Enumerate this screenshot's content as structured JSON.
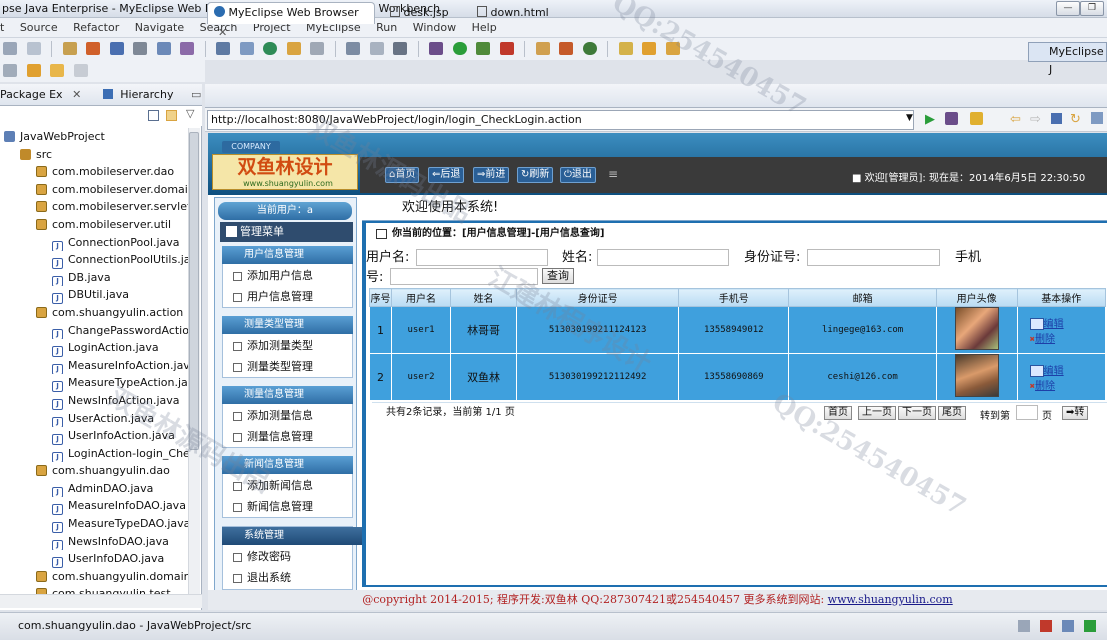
{
  "window": {
    "title": "pse Java Enterprise - MyEclipse Web Browser - MyEclipse Enterprise Workbench"
  },
  "menu": [
    "t",
    "Source",
    "Refactor",
    "Navigate",
    "Search",
    "Project",
    "MyEclipse",
    "Run",
    "Window",
    "Help"
  ],
  "perspective": "MyEclipse J",
  "left_panel": {
    "tabs": [
      "Package Ex",
      "Hierarchy"
    ],
    "tree": [
      {
        "label": "JavaWebProject",
        "icon": "project-icon",
        "indent": 0
      },
      {
        "label": "src",
        "icon": "source-folder-icon",
        "indent": 1
      },
      {
        "label": "com.mobileserver.dao",
        "icon": "package-icon",
        "indent": 2
      },
      {
        "label": "com.mobileserver.domain",
        "icon": "package-icon",
        "indent": 2
      },
      {
        "label": "com.mobileserver.servlet",
        "icon": "package-icon",
        "indent": 2
      },
      {
        "label": "com.mobileserver.util",
        "icon": "package-icon",
        "indent": 2
      },
      {
        "label": "ConnectionPool.java",
        "icon": "java-file-icon",
        "indent": 3
      },
      {
        "label": "ConnectionPoolUtils.jav",
        "icon": "java-file-icon",
        "indent": 3
      },
      {
        "label": "DB.java",
        "icon": "java-file-icon",
        "indent": 3
      },
      {
        "label": "DBUtil.java",
        "icon": "java-file-icon",
        "indent": 3
      },
      {
        "label": "com.shuangyulin.action",
        "icon": "package-icon",
        "indent": 2
      },
      {
        "label": "ChangePasswordAction",
        "icon": "java-file-icon",
        "indent": 3
      },
      {
        "label": "LoginAction.java",
        "icon": "java-file-icon",
        "indent": 3
      },
      {
        "label": "MeasureInfoAction.java",
        "icon": "java-file-icon",
        "indent": 3
      },
      {
        "label": "MeasureTypeAction.jav",
        "icon": "java-file-icon",
        "indent": 3
      },
      {
        "label": "NewsInfoAction.java",
        "icon": "java-file-icon",
        "indent": 3
      },
      {
        "label": "UserAction.java",
        "icon": "java-file-icon",
        "indent": 3
      },
      {
        "label": "UserInfoAction.java",
        "icon": "java-file-icon",
        "indent": 3
      },
      {
        "label": "LoginAction-login_Chec",
        "icon": "xml-file-icon",
        "indent": 3
      },
      {
        "label": "com.shuangyulin.dao",
        "icon": "package-icon",
        "indent": 2
      },
      {
        "label": "AdminDAO.java",
        "icon": "java-file-icon",
        "indent": 3
      },
      {
        "label": "MeasureInfoDAO.java",
        "icon": "java-file-icon",
        "indent": 3
      },
      {
        "label": "MeasureTypeDAO.java",
        "icon": "java-file-icon",
        "indent": 3
      },
      {
        "label": "NewsInfoDAO.java",
        "icon": "java-file-icon",
        "indent": 3
      },
      {
        "label": "UserInfoDAO.java",
        "icon": "java-file-icon",
        "indent": 3
      },
      {
        "label": "com.shuangyulin.domain",
        "icon": "package-icon",
        "indent": 2
      },
      {
        "label": "com.shuangyulin.test",
        "icon": "package-icon",
        "indent": 2
      }
    ]
  },
  "editor": {
    "tabs": [
      "MyEclipse Web Browser",
      "desk.jsp",
      "down.html"
    ],
    "url": "http://localhost:8080/JavaWebProject/login/login_CheckLogin.action"
  },
  "site": {
    "company": "COMPANY",
    "logo": "双鱼林设计",
    "logo_url": "www.shuangyulin.com",
    "nav": [
      "首页",
      "后退",
      "前进",
      "刷新",
      "退出"
    ],
    "welcome_top": "■ 欢迎[管理员]:  现在是：2014年6月5日 22:30:50",
    "current_user": "当前用户：a",
    "menu_title": "管理菜单",
    "groups": [
      {
        "title": "用户信息管理",
        "items": [
          "添加用户信息",
          "用户信息管理"
        ]
      },
      {
        "title": "测量类型管理",
        "items": [
          "添加测量类型",
          "测量类型管理"
        ]
      },
      {
        "title": "测量信息管理",
        "items": [
          "添加测量信息",
          "测量信息管理"
        ]
      },
      {
        "title": "新闻信息管理",
        "items": [
          "添加新闻信息",
          "新闻信息管理"
        ]
      },
      {
        "title": "系统管理",
        "items": [
          "修改密码",
          "退出系统"
        ]
      }
    ],
    "welcome": "欢迎使用本系统!",
    "location": "你当前的位置：[用户信息管理]-[用户信息查询]",
    "search": {
      "username_label": "用户名:",
      "name_label": "姓名:",
      "idcard_label": "身份证号:",
      "phone_label": "手机",
      "phone_label_cont": "号:",
      "button": "查询"
    },
    "table": {
      "columns": [
        "序号",
        "用户名",
        "姓名",
        "身份证号",
        "手机号",
        "邮箱",
        "用户头像",
        "基本操作"
      ],
      "rows": [
        [
          "1",
          "user1",
          "林哥哥",
          "513030199211124123",
          "13558949012",
          "lingege@163.com"
        ],
        [
          "2",
          "user2",
          "双鱼林",
          "513030199212112492",
          "13558690869",
          "ceshi@126.com"
        ]
      ],
      "edit": "编辑",
      "delete": "删除"
    },
    "pager": {
      "summary": "共有2条记录，当前第 1/1 页",
      "buttons": [
        "首页",
        "上一页",
        "下一页",
        "尾页"
      ],
      "goto_label": "转到第",
      "page_unit": "页",
      "go": "转"
    },
    "footer": "@copyright 2014-2015; 程序开发:双鱼林  QQ:287307421或254540457  更多系统到网站:",
    "footer_link": "www.shuangyulin.com"
  },
  "status": "com.shuangyulin.dao - JavaWebProject/src"
}
